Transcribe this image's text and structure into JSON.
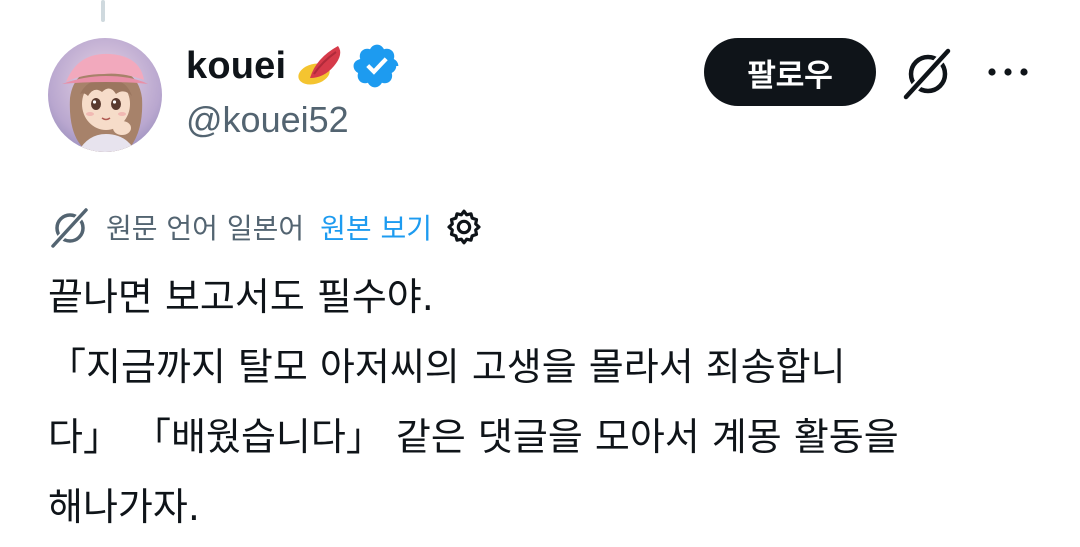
{
  "author": {
    "display_name": "kouei",
    "name_emoji": "sweet-potato-emoji",
    "verified": true,
    "handle": "@kouei52"
  },
  "actions": {
    "follow_label": "팔로우",
    "grok_icon": "grok-icon",
    "more_icon": "more-icon"
  },
  "translation": {
    "language_label": "원문 언어 일본어",
    "view_original_label": "원본 보기"
  },
  "post": {
    "lines": [
      "끝나면 보고서도 필수야.",
      "「지금까지 탈모 아저씨의 고생을 몰라서 죄송합니",
      "다」 「배웠습니다」 같은 댓글을 모아서 계몽 활동을",
      "해나가자."
    ]
  },
  "colors": {
    "primary_text": "#0f1419",
    "secondary_text": "#536471",
    "link_blue": "#1d9bf0",
    "follow_button_bg": "#0f1419",
    "verified_blue": "#1d9bf0"
  }
}
